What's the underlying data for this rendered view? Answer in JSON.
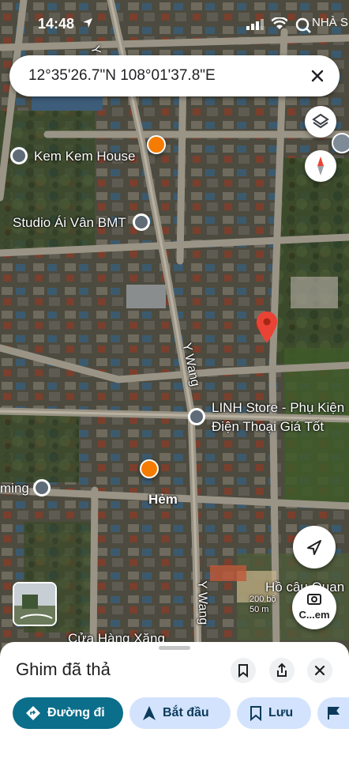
{
  "status_bar": {
    "time": "14:48",
    "carrier": "NHÀ S"
  },
  "search": {
    "coordinates": "12°35'26.7\"N 108°01'37.8\"E"
  },
  "map": {
    "street_labels": [
      "Y Wang",
      "Y Wang",
      "Y Wang",
      "Hẻm"
    ],
    "places": [
      {
        "name": "Kem Kem House"
      },
      {
        "name": "Studio Ái Vân BMT"
      },
      {
        "name": "LINH Store - Phụ Kiện"
      },
      {
        "name": "Điện Thoại Giá Tốt"
      },
      {
        "name": "ming"
      },
      {
        "name": "Hồ câu Quan"
      },
      {
        "name": "Cửa Hàng Xăng"
      }
    ],
    "lens_label": "C...em",
    "scale_text": "200 bộ\n50 m"
  },
  "sheet": {
    "title": "Ghim đã thả",
    "chips": [
      {
        "label": "Đường đi"
      },
      {
        "label": "Bắt đầu"
      },
      {
        "label": "Lưu"
      }
    ]
  },
  "colors": {
    "primary": "#0b57d0",
    "directions_chip": "#0b6e8b",
    "chip_bg": "#d3e3fd",
    "pin": "#ea4335"
  }
}
